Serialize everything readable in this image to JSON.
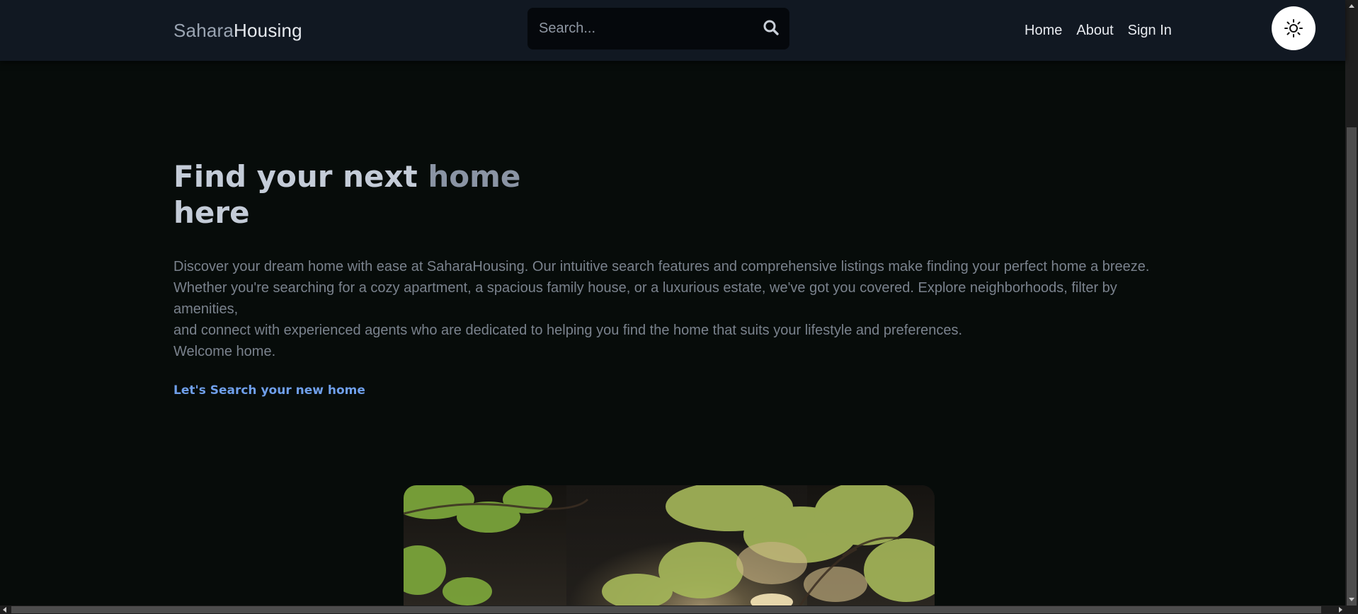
{
  "header": {
    "logo_part1": "Sahara",
    "logo_part2": "Housing",
    "search_placeholder": "Search...",
    "search_icon": "search-icon",
    "nav": [
      {
        "label": "Home"
      },
      {
        "label": "About"
      },
      {
        "label": "Sign In"
      }
    ],
    "theme_toggle_icon": "sun-icon"
  },
  "hero": {
    "title_prefix": "Find your next ",
    "title_accent": "home",
    "title_suffix": "here",
    "description_lines": [
      "Discover your dream home with ease at SaharaHousing. Our intuitive search features and comprehensive listings make finding your perfect home a breeze.",
      "Whether you're searching for a cozy apartment, a spacious family house, or a luxurious estate, we've got you covered. Explore neighborhoods, filter by amenities,",
      "and connect with experienced agents who are dedicated to helping you find the home that suits your lifestyle and preferences.",
      "Welcome home."
    ],
    "cta_label": "Let's Search your new home"
  },
  "colors": {
    "background": "#070c0a",
    "header_bg": "#111822",
    "search_bg": "#05080c",
    "cta": "#6f9fea",
    "title": "#c4ccd8",
    "title_accent": "#8a94a4",
    "body_text": "#7a828d"
  }
}
